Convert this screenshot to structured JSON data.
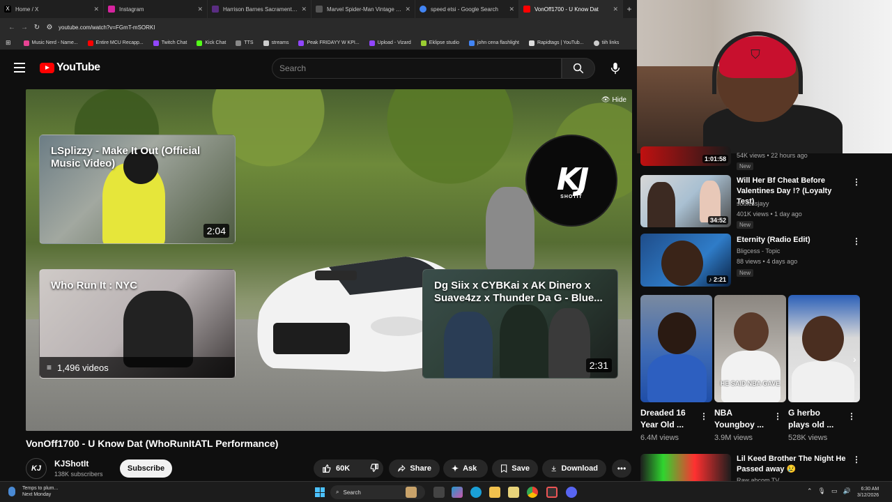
{
  "browser": {
    "tabs": [
      {
        "label": "Home / X",
        "color": "#000000"
      },
      {
        "label": "Instagram",
        "color": "#d6249f"
      },
      {
        "label": "Harrison Barnes Sacramento Ki...",
        "color": "#5a2d82"
      },
      {
        "label": "Marvel Spider-Man Vintage Co...",
        "color": "#3a3a3a"
      },
      {
        "label": "speed etsi - Google Search",
        "color": "#4285f4"
      },
      {
        "label": "VonOff1700 - U Know Dat",
        "color": "#ff0000"
      }
    ],
    "url": "youtube.com/watch?v=FGmT-mSORKI",
    "bookmarks": [
      {
        "label": "Music Nerd - Name...",
        "color": "#e84393"
      },
      {
        "label": "Entire MCU Recapp...",
        "color": "#ff0000"
      },
      {
        "label": "Twitch Chat",
        "color": "#9146ff"
      },
      {
        "label": "Kick Chat",
        "color": "#53fc18"
      },
      {
        "label": "TTS",
        "color": "#888888"
      },
      {
        "label": "streams",
        "color": "#cccccc"
      },
      {
        "label": "Peak FRIDAYY W KPI...",
        "color": "#9146ff"
      },
      {
        "label": "Upload - Vizard",
        "color": "#9146ff"
      },
      {
        "label": "Eklipse studio",
        "color": "#9acd32"
      },
      {
        "label": "john cena flashlight",
        "color": "#4285f4"
      },
      {
        "label": "Rapidtags | YouTub...",
        "color": "#dddddd"
      },
      {
        "label": "tiih links",
        "color": "#cccccc"
      }
    ]
  },
  "header": {
    "brand": "YouTube",
    "search_placeholder": "Search"
  },
  "player": {
    "hide_label": "Hide",
    "logo_mark": "KJ",
    "logo_sub": "SHOTIT",
    "endcards": [
      {
        "title": "LSplizzy - Make It Out (Official Music Video)",
        "duration": "2:04"
      },
      {
        "title": "Who Run It : NYC",
        "playlist_count": "1,496 videos"
      },
      {
        "title": "Dg Siix x CYBKai x AK Dinero x Suave4zz x Thunder Da G - Blue...",
        "duration": "2:31"
      }
    ]
  },
  "video": {
    "title": "VonOff1700 - U Know Dat (WhoRunItATL Performance)",
    "channel": "KJShotIt",
    "subscribers": "138K subscribers",
    "subscribe_label": "Subscribe",
    "likes": "60K",
    "share_label": "Share",
    "ask_label": "Ask",
    "save_label": "Save",
    "download_label": "Download"
  },
  "sidebar": {
    "top_item": {
      "meta": "54K views • 22 hours ago",
      "duration": "1:01:58",
      "badge": "New"
    },
    "items": [
      {
        "title": "Will Her Bf Cheat Before Valentines Day !? (Loyalty Test)",
        "channel": "soulessjayy",
        "meta": "401K views • 1 day ago",
        "duration": "34:52",
        "badge": "New"
      },
      {
        "title": "Eternity (Radio Edit)",
        "channel": "Bligcess - Topic",
        "meta": "88 views • 4 days ago",
        "duration": "2:21",
        "badge": "New"
      }
    ],
    "shorts": [
      {
        "title": "Dreaded 16 Year Old ...",
        "views": "6.4M views",
        "overlay": ""
      },
      {
        "title": "NBA Youngboy ...",
        "views": "3.9M views",
        "overlay": "HE SAID NBA GAVE"
      },
      {
        "title": "G herbo plays old ...",
        "views": "528K views",
        "overlay": ""
      }
    ],
    "bottom_item": {
      "title": "Lil Keed Brother The Night He Passed away 😢",
      "channel": "Raw ahcom TV"
    }
  },
  "taskbar": {
    "weather_line1": "Temps to plum...",
    "weather_line2": "Next Monday",
    "search_label": "Search",
    "time": "6:30 AM",
    "date": "3/12/2026"
  },
  "colors": {
    "accent": "#ff0000",
    "bg": "#0f0f0f"
  }
}
